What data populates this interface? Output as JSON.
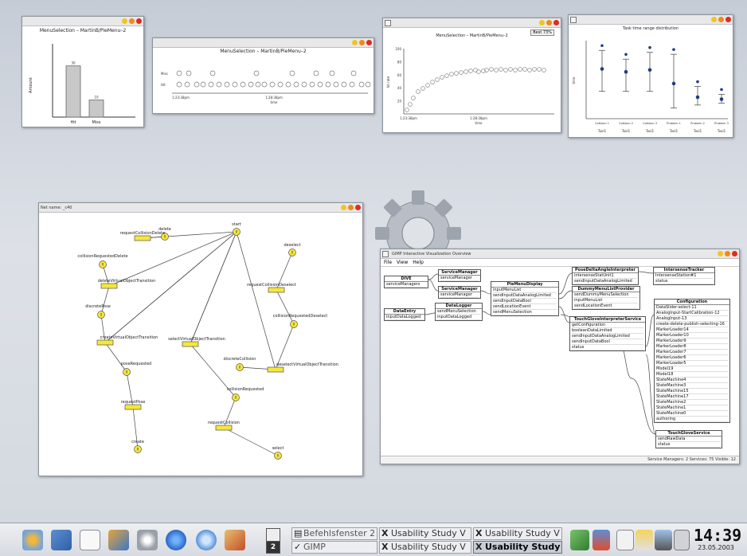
{
  "window1": {
    "title": "MenuSelection – MartinB/PieMenu–2",
    "ylabel": "Amount",
    "categories": [
      "Hit",
      "Miss"
    ],
    "values": [
      30,
      10
    ],
    "value_labels": [
      "30",
      "10"
    ]
  },
  "window2": {
    "title": "MenuSelection – MartinB/PieMenu–2",
    "rows": [
      "Miss",
      "Hit"
    ],
    "tick_labels": [
      "1:23:38pm",
      "1:28:38pm"
    ],
    "xlabel": "time"
  },
  "window3": {
    "title": "MenuSelection – MartinB/PieMenu–2",
    "badge": "Best 73%",
    "yticks": [
      "100",
      "80",
      "60",
      "40",
      "20"
    ],
    "ylabel": "hit rate",
    "xticks": [
      "1:23:38pm",
      "1:28:38pm"
    ],
    "xlabel": "time"
  },
  "window4": {
    "title": "Task time range distribution",
    "ylabel": "time",
    "categories": [
      "Collision 1",
      "Collision 2",
      "Collision 3",
      "Problem 1",
      "Problem 2",
      "Problem 3"
    ],
    "tool_labels": [
      "Tool1",
      "Tool1",
      "Tool1",
      "Tool1",
      "Tool1",
      "Tool1"
    ],
    "means": [
      255,
      240,
      250,
      180,
      110,
      100
    ],
    "mins": [
      140,
      140,
      140,
      55,
      70,
      80
    ],
    "maxs": [
      350,
      305,
      340,
      330,
      165,
      125
    ]
  },
  "petri": {
    "net_name_label": "Net name:",
    "net_name_value": "_c40",
    "places": [
      "delete",
      "start",
      "deselect",
      "collisionRequestedDelete",
      "discretePose",
      "collisionRequestedDeselect",
      "poseRequested",
      "discreteCollision",
      "collisionRequested",
      "create",
      "select"
    ],
    "transitions": [
      "requestCollisionDelete",
      "deleteVirtualObjectTransition",
      "requestCollisionDeselect",
      "createVirtualObjectTransition",
      "selectVirtualObjectTransition",
      "deselectVirtualObjectTransition",
      "requestPose",
      "requestCollision"
    ]
  },
  "viz": {
    "title": "GIMP Interactive Visualization Overview",
    "menu": [
      "File",
      "View",
      "Help"
    ],
    "status": "Service Managers: 2  Services: 75  Visible: 12",
    "nodes": {
      "dive": {
        "title": "DIVE",
        "rows": [
          "serviceManagers"
        ]
      },
      "sm1": {
        "title": "ServiceManager",
        "rows": [
          "serviceManager"
        ]
      },
      "sm2": {
        "title": "ServiceManager",
        "rows": [
          "serviceManager"
        ]
      },
      "pie": {
        "title": "PieMenuDisplay",
        "rows": [
          "inputMenuList",
          "sendInputDataAnalogLimited",
          "sendInputDataBool",
          "sendLocationEvent",
          "sendMenuSelection"
        ]
      },
      "datalogger": {
        "title": "DataLogger",
        "rows": [
          "sendMenuSelection",
          "inputDataLogged"
        ]
      },
      "dataentry": {
        "title": "DataEntry",
        "rows": [
          "inputDataLogged"
        ]
      },
      "pose": {
        "title": "PoseDeltaAngleInterpreter",
        "rows": [
          "intersenseStatUnit1",
          "sendInputDataAnalogLimited"
        ]
      },
      "dummy": {
        "title": "DummyMenuListProvider",
        "rows": [
          "sendDummyMenuSelection",
          "inputMenuList",
          "sendLocationEvent"
        ]
      },
      "touch": {
        "title": "TouchGloveInterpreterService",
        "rows": [
          "getConfiguration",
          "booleanDataLimited",
          "sendInputDataAnalogLimited",
          "sendInputDataBool",
          "status"
        ]
      },
      "intersense": {
        "title": "IntersenseTracker",
        "rows": [
          "IntersenseStation#1",
          "status"
        ]
      },
      "config": {
        "title": "Configuration",
        "rows": [
          "DataSlider-select-11",
          "AnalogInput-StartCalibration-12",
          "AnalogInput-13",
          "create-delete-publish-selecting-16",
          "MarkerLoader14",
          "MarkerLoader10",
          "MarkerLoader9",
          "MarkerLoader8",
          "MarkerLoader7",
          "MarkerLoader6",
          "MarkerLoader5",
          "Model19",
          "Model18",
          "StateMachine4",
          "StateMachine3",
          "StateMachine15",
          "StateMachine17",
          "StateMachine2",
          "StateMachine1",
          "StateMachine0",
          "authoring"
        ]
      },
      "tgs": {
        "title": "TouchGloveService",
        "rows": [
          "sendRawData",
          "status"
        ]
      }
    }
  },
  "taskbar": {
    "tasks_top": [
      "Befehlsfenster 2",
      "Usability Study V",
      "Usability Study V"
    ],
    "tasks_bottom": [
      "GIMP",
      "Usability Study V",
      "Usability Study"
    ],
    "active_task": "Usability Study",
    "desktop_number": "2",
    "clock_time": "14:39",
    "clock_date": "23.05.2003"
  }
}
